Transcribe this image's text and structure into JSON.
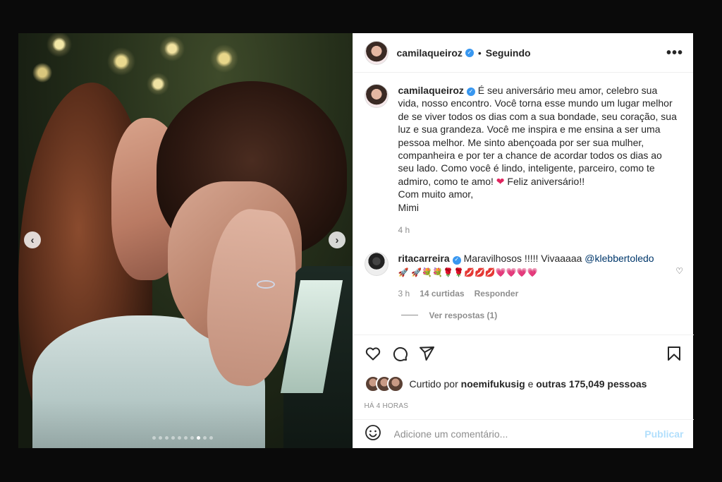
{
  "post": {
    "username": "camilaqueiroz",
    "separator": "•",
    "follow_status": "Seguindo",
    "more_label": "•••"
  },
  "carousel": {
    "prev_label": "‹",
    "next_label": "›",
    "slide_count": 10,
    "active_index": 8
  },
  "caption": {
    "username": "camilaqueiroz",
    "text_1": "É seu aniversário meu amor, celebro sua vida, nosso encontro. Você torna esse mundo um lugar melhor de se viver todos os dias com a sua bondade, seu coração, sua luz e sua grandeza. Você me inspira e me ensina a ser uma pessoa melhor. Me sinto abençoada por ser sua mulher, companheira e por ter a chance de acordar todos os dias ao seu lado. Como você é lindo, inteligente, parceiro, como te admiro, como te amo!",
    "heart": "❤",
    "text_2": "Feliz aniversário!!",
    "line_3": "Com muito amor,",
    "line_4": "Mimi",
    "time": "4 h"
  },
  "comment": {
    "username": "ritacarreira",
    "text": "Maravilhosos !!!!! Vivaaaaa",
    "mention": "@klebbertoledo",
    "emojis_1": "🚀",
    "emojis_2": "🚀💐💐🌹🌹💋💋💋💗💗💗💗",
    "time": "3 h",
    "likes": "14 curtidas",
    "reply": "Responder",
    "view_replies": "Ver respostas (1)"
  },
  "likes": {
    "prefix": "Curtido por",
    "user": "noemifukusig",
    "middle": "e",
    "others": "outras 175,049 pessoas"
  },
  "timestamp": "HÁ 4 HORAS",
  "add_comment": {
    "placeholder": "Adicione um comentário...",
    "publish": "Publicar"
  },
  "colors": {
    "verified": "#3897f0",
    "heart": "#e0245e",
    "publish_disabled": "#b2dffc"
  }
}
